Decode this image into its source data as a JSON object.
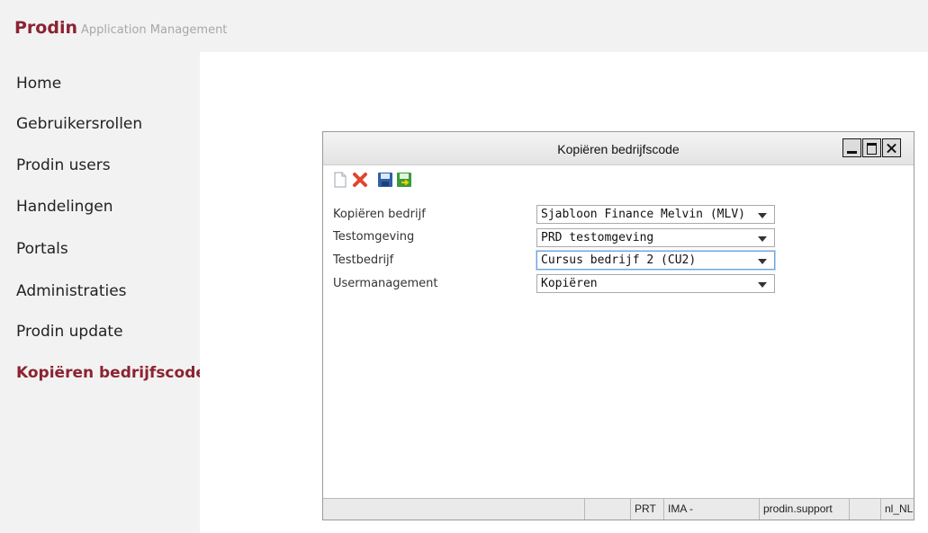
{
  "header": {
    "brand": "Prodin",
    "subtitle": "Application Management"
  },
  "sidebar": {
    "items": [
      {
        "label": "Home"
      },
      {
        "label": "Gebruikersrollen"
      },
      {
        "label": "Prodin users"
      },
      {
        "label": "Handelingen"
      },
      {
        "label": "Portals"
      },
      {
        "label": "Administraties"
      },
      {
        "label": "Prodin update"
      },
      {
        "label": "Kopiëren bedrijfscode",
        "active": true
      }
    ]
  },
  "dialog": {
    "title": "Kopiëren bedrijfscode",
    "toolbar": {
      "icons": [
        "new-document-icon",
        "delete-icon",
        "save-icon",
        "save-and-close-icon"
      ]
    },
    "fields": [
      {
        "label": "Kopiëren bedrijf",
        "value": "Sjabloon Finance Melvin (MLV)"
      },
      {
        "label": "Testomgeving",
        "value": "PRD testomgeving"
      },
      {
        "label": "Testbedrijf",
        "value": "Cursus bedrijf 2 (CU2)"
      },
      {
        "label": "Usermanagement",
        "value": "Kopiëren"
      }
    ],
    "status": {
      "cell1": "",
      "cell2": "",
      "env": "PRT",
      "ima": "IMA -",
      "user": "prodin.support",
      "cell6": "",
      "locale": "nl_NL"
    }
  },
  "colors": {
    "brand": "#8b2332",
    "sidebar_bg": "#f2f2f2",
    "focus": "#6fa4dd"
  }
}
